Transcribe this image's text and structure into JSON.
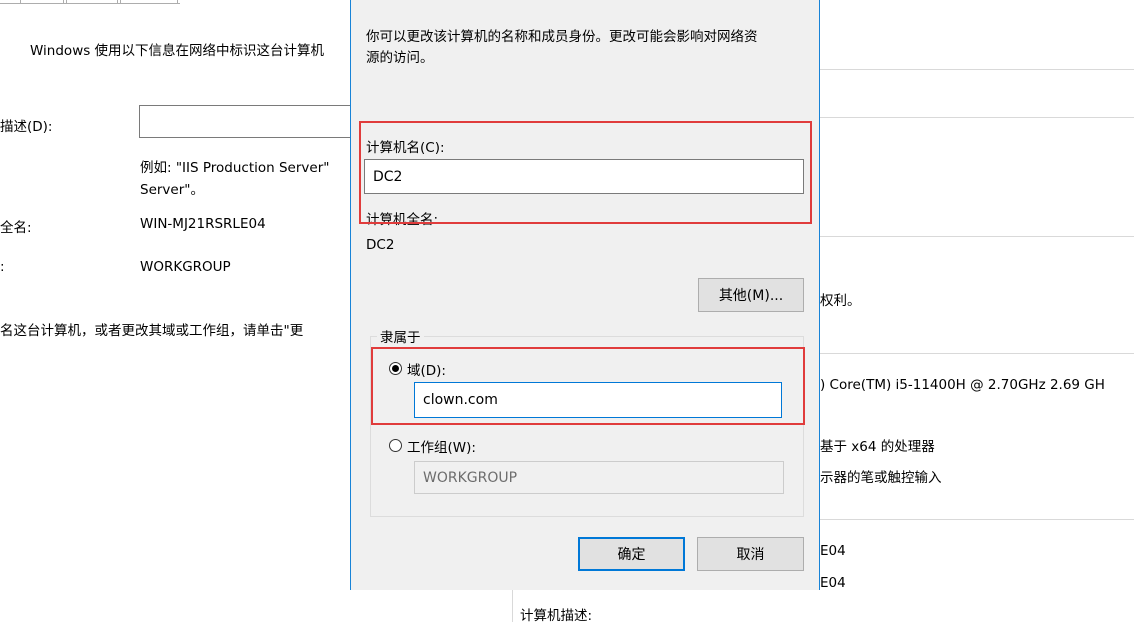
{
  "system_properties": {
    "intro": "Windows 使用以下信息在网络中标识这台计算机",
    "description_label": "描述(D):",
    "description_value": "",
    "example_line1": "例如: \"IIS Production Server\"",
    "example_line2": "Server\"。",
    "full_name_label": "全名:",
    "full_name_value": "WIN-MJ21RSRLE04",
    "workgroup_label": ":",
    "workgroup_value": "WORKGROUP",
    "rename_hint": "名这台计算机，或者更改其域或工作组，请单击\"更"
  },
  "system_panel": {
    "rights_fragment": "权利。",
    "processor_fragment": ") Core(TM) i5-11400H @ 2.70GHz   2.69 GH",
    "system_type_fragment": "基于 x64 的处理器",
    "pen_touch_fragment": "示器的笔或触控输入",
    "computer_name_fragment": "E04",
    "full_name_fragment": "E04",
    "computer_desc_label": "计算机描述:"
  },
  "dialog": {
    "intro_line1": "你可以更改该计算机的名称和成员身份。更改可能会影响对网络资",
    "intro_line2": "源的访问。",
    "computer_name_label": "计算机名(C):",
    "computer_name_value": "DC2",
    "full_name_label": "计算机全名:",
    "full_name_value": "DC2",
    "more_button": "其他(M)...",
    "member_of_label": "隶属于",
    "domain_label": "域(D):",
    "domain_value": "clown.com",
    "workgroup_label": "工作组(W):",
    "workgroup_value": "WORKGROUP",
    "ok_button": "确定",
    "cancel_button": "取消",
    "selected_membership": "domain"
  },
  "colors": {
    "dialog_bg": "#f0f0f0",
    "accent": "#0078d7",
    "highlight": "#e03c3c",
    "button_bg": "#e1e1e1"
  }
}
